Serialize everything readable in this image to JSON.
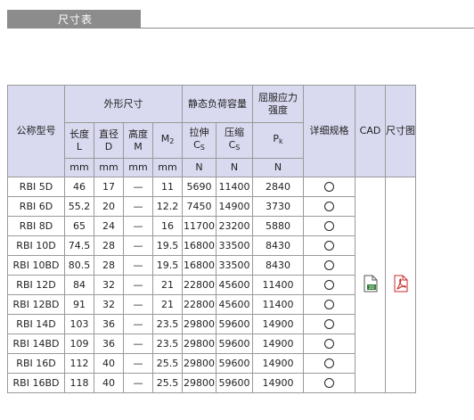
{
  "tab": {
    "label": "尺寸表"
  },
  "headers": {
    "model": "公称型号",
    "outer_size": "外形尺寸",
    "static_load": "静态负荷容量",
    "yield_strength": "屈服应力强度",
    "details": "详细规格",
    "cad": "CAD",
    "dimension_drawing": "尺寸图",
    "length": "长度",
    "length_sym": "L",
    "diameter": "直径",
    "diameter_sym": "D",
    "height": "高度",
    "height_sym": "M",
    "m2": "M",
    "m2_sub": "2",
    "tension": "拉伸",
    "tension_sym": "C",
    "tension_sub": "S",
    "compression": "压缩",
    "compression_sym": "C",
    "compression_sub": "S",
    "pk": "P",
    "pk_sub": "k"
  },
  "units": [
    "mm",
    "mm",
    "mm",
    "mm",
    "N",
    "N",
    "N"
  ],
  "rows": [
    {
      "model": "RBI 5D",
      "L": "46",
      "D": "17",
      "M": "—",
      "M2": "11",
      "CS1": "5690",
      "CS2": "11400",
      "Pk": "2840"
    },
    {
      "model": "RBI 6D",
      "L": "55.2",
      "D": "20",
      "M": "—",
      "M2": "12.2",
      "CS1": "7450",
      "CS2": "14900",
      "Pk": "3730"
    },
    {
      "model": "RBI 8D",
      "L": "65",
      "D": "24",
      "M": "—",
      "M2": "16",
      "CS1": "11700",
      "CS2": "23200",
      "Pk": "5880"
    },
    {
      "model": "RBI 10D",
      "L": "74.5",
      "D": "28",
      "M": "—",
      "M2": "19.5",
      "CS1": "16800",
      "CS2": "33500",
      "Pk": "8430"
    },
    {
      "model": "RBI 10BD",
      "L": "80.5",
      "D": "28",
      "M": "—",
      "M2": "19.5",
      "CS1": "16800",
      "CS2": "33500",
      "Pk": "8430"
    },
    {
      "model": "RBI 12D",
      "L": "84",
      "D": "32",
      "M": "—",
      "M2": "21",
      "CS1": "22800",
      "CS2": "45600",
      "Pk": "11400"
    },
    {
      "model": "RBI 12BD",
      "L": "91",
      "D": "32",
      "M": "—",
      "M2": "21",
      "CS1": "22800",
      "CS2": "45600",
      "Pk": "11400"
    },
    {
      "model": "RBI 14D",
      "L": "103",
      "D": "36",
      "M": "—",
      "M2": "23.5",
      "CS1": "29800",
      "CS2": "59600",
      "Pk": "14900"
    },
    {
      "model": "RBI 14BD",
      "L": "109",
      "D": "36",
      "M": "—",
      "M2": "23.5",
      "CS1": "29800",
      "CS2": "59600",
      "Pk": "14900"
    },
    {
      "model": "RBI 16D",
      "L": "112",
      "D": "40",
      "M": "—",
      "M2": "25.5",
      "CS1": "29800",
      "CS2": "59600",
      "Pk": "14900"
    },
    {
      "model": "RBI 16BD",
      "L": "118",
      "D": "40",
      "M": "—",
      "M2": "25.5",
      "CS1": "29800",
      "CS2": "59600",
      "Pk": "14900"
    }
  ],
  "icons": {
    "cad": "cad-3d-file-icon",
    "drawing": "pdf-file-icon",
    "detail": "circle-icon"
  }
}
